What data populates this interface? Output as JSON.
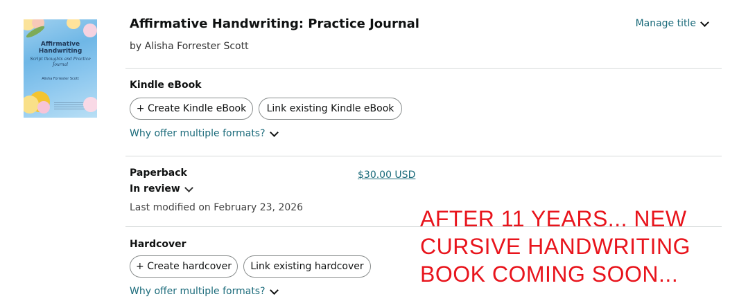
{
  "book": {
    "title": "Affirmative Handwriting: Practice Journal",
    "author_line": "by Alisha Forrester Scott",
    "manage_label": "Manage title",
    "cover": {
      "title": "Affirmative Handwriting",
      "subtitle": "Script thoughts and Practice Journal",
      "author": "Alisha Forrester Scott"
    }
  },
  "kindle": {
    "heading": "Kindle eBook",
    "create_label": "+ Create Kindle eBook",
    "link_label": "Link existing Kindle eBook",
    "why_label": "Why offer multiple formats?"
  },
  "paperback": {
    "heading": "Paperback",
    "status": "In review",
    "modified": "Last modified on February 23, 2026",
    "price": "$30.00 USD"
  },
  "hardcover": {
    "heading": "Hardcover",
    "create_label": "+ Create hardcover",
    "link_label": "Link existing hardcover",
    "why_label": "Why offer multiple formats?"
  },
  "announcement": {
    "lines": [
      "AFTER 11 YEARS... NEW",
      "CURSIVE HANDWRITING",
      "BOOK COMING SOON..."
    ],
    "color": "#e8141c"
  },
  "colors": {
    "link": "#1a6a7a",
    "divider": "#d5d9d9"
  }
}
